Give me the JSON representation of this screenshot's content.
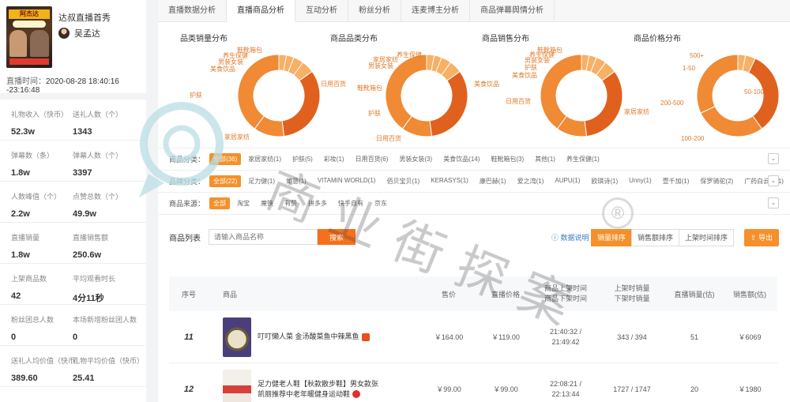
{
  "live": {
    "cover_text": "阿杰达",
    "title": "达叔直播首秀",
    "host": "吴孟达",
    "time_label": "直播时间：",
    "time_value": "2020-08-28 18:40:16 -23:16:48"
  },
  "stats": [
    {
      "l_label": "礼物收入（快币）",
      "l_value": "52.3w",
      "r_label": "送礼人数（个）",
      "r_value": "1343"
    },
    {
      "l_label": "弹幕数（条）",
      "l_value": "1.8w",
      "r_label": "弹幕人数（个）",
      "r_value": "3397"
    },
    {
      "l_label": "人数峰值（个）",
      "l_value": "2.2w",
      "r_label": "点赞总数（个）",
      "r_value": "49.9w"
    },
    {
      "l_label": "直播销量",
      "l_value": "1.8w",
      "r_label": "直播销售额",
      "r_value": "250.6w"
    },
    {
      "l_label": "上架商品数",
      "l_value": "42",
      "r_label": "平均观看时长",
      "r_value": "4分11秒"
    },
    {
      "l_label": "粉丝团总人数",
      "l_value": "0",
      "r_label": "本场新增粉丝团人数",
      "r_value": "0"
    },
    {
      "l_label": "送礼人均价值（快币）",
      "l_value": "389.60",
      "r_label": "礼物平均价值（快币）",
      "r_value": "25.41"
    }
  ],
  "tabs": [
    "直播数据分析",
    "直播商品分析",
    "互动分析",
    "粉丝分析",
    "连麦博主分析",
    "商品弹幕舆情分析"
  ],
  "active_tab": 1,
  "charts": [
    {
      "title": "品类销量分布",
      "labels": [
        "鞋靴箱包",
        "养生保健",
        "男装女装",
        "美食饮品",
        "日用百货",
        "护肤",
        "家居家纺"
      ]
    },
    {
      "title": "商品品类分布",
      "labels": [
        "养生保健",
        "家居家纺",
        "男装女装",
        "鞋靴箱包",
        "美食饮品",
        "护肤",
        "日用百货"
      ]
    },
    {
      "title": "商品销售分布",
      "labels": [
        "鞋靴箱包",
        "养生保健",
        "男装女装",
        "护肤",
        "美食饮品",
        "日用百货",
        "家居家纺"
      ]
    },
    {
      "title": "商品价格分布",
      "labels": [
        "500+",
        "1-50",
        "50-100",
        "200-500",
        "100-200"
      ]
    }
  ],
  "filters": {
    "category": {
      "label": "商品分类：",
      "chips": [
        "全部(36)",
        "家居家纺(1)",
        "护肤(5)",
        "彩妆(1)",
        "日用百货(6)",
        "男装女装(3)",
        "美食饮品(14)",
        "鞋靴箱包(3)",
        "其他(1)",
        "养生保健(1)"
      ]
    },
    "brand": {
      "label": "品牌分类：",
      "chips": [
        "全部(22)",
        "足力健(1)",
        "如意(1)",
        "VITAMIN WORLD(1)",
        "佰贝宝贝(1)",
        "KERASYS(1)",
        "康巴赫(1)",
        "爱之湾(1)",
        "AUPU(1)",
        "欧琪诗(1)",
        "Unny(1)",
        "壹千加(1)",
        "保罗骑驼(2)",
        "广药白云山(1)"
      ]
    },
    "source": {
      "label": "商品来源：",
      "chips": [
        "全部",
        "淘宝",
        "魔筷",
        "有赞",
        "拼多多",
        "快手自有",
        "京东"
      ]
    }
  },
  "list": {
    "label": "商品列表",
    "search_placeholder": "请输入商品名称",
    "search_button": "搜索",
    "help": "数据说明",
    "sorts": [
      "销量排序",
      "销售额排序",
      "上架时间排序"
    ],
    "export": "导出"
  },
  "table": {
    "headers": [
      "序号",
      "商品",
      "售价",
      "直播价格",
      "商品上架时间\n商品下架时间",
      "上架时销量\n下架时销量",
      "直播销量(估)",
      "销售额(估)"
    ],
    "rows": [
      {
        "no": "11",
        "name": "叮叮懒人菜 金汤酸菜鱼中辣黑鱼",
        "price": "￥164.00",
        "live_price": "￥119.00",
        "on": "21:40:32 /",
        "off": "21:49:42",
        "stock": "343 / 394",
        "sales": "51",
        "amount": "￥6069"
      },
      {
        "no": "12",
        "name": "足力健老人鞋【秋款散步鞋】男女款张凯丽推荐中老年暖健身运动鞋",
        "price": "￥99.00",
        "live_price": "￥99.00",
        "on": "22:08:21 /",
        "off": "22:13:44",
        "stock": "1727 / 1747",
        "sales": "20",
        "amount": "￥1980"
      }
    ]
  },
  "watermark": "商业街探案",
  "colors": {
    "accent": "#f5902a",
    "donut_dark": "#e0611e",
    "donut_mid": "#f08a35",
    "donut_light": "#f7b065"
  }
}
